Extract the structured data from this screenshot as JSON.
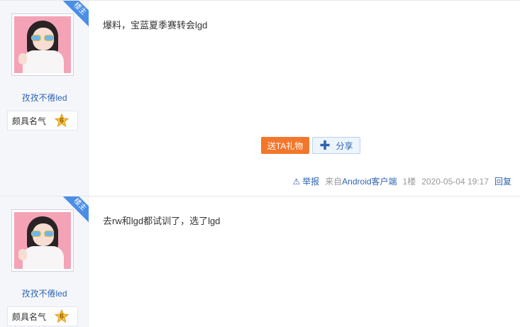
{
  "posts": [
    {
      "author_tag": "楼主",
      "username": "孜孜不倦led",
      "badge_label": "颇具名气",
      "badge_level": "6",
      "text": "爆料，宝蓝夏季赛转会lgd",
      "gift_label": "送TA礼物",
      "share_label": "分享",
      "report_label": "举报",
      "source_prefix": "来自",
      "source_name": "Android客户端",
      "floor": "1楼",
      "time": "2020-05-04 19:17",
      "reply_label": "回复"
    },
    {
      "author_tag": "楼主",
      "username": "孜孜不倦led",
      "badge_label": "颇具名气",
      "badge_level": "6",
      "text": "去rw和lgd都试训了，选了lgd"
    }
  ],
  "colors": {
    "link": "#2d64b3",
    "gift_button": "#f3772b",
    "ribbon": "#4a8ee6",
    "sidebar_bg": "#f5f6fa"
  },
  "icons": [
    "warning-icon",
    "plus-icon",
    "star-icon"
  ]
}
